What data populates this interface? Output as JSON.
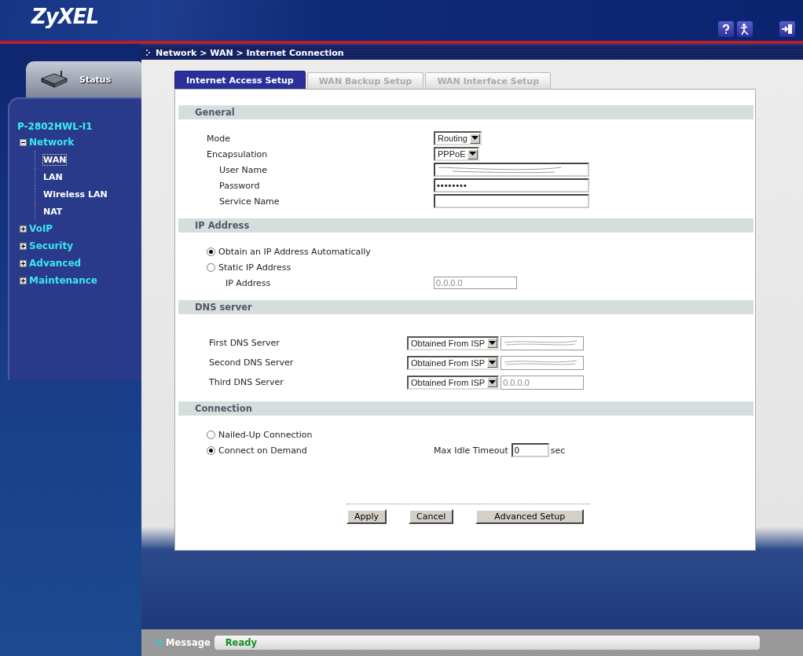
{
  "header": {
    "logo": "ZyXEL"
  },
  "sidebar": {
    "status_tab": "Status",
    "device": "P-2802HWL-I1",
    "tree": [
      {
        "label": "Network",
        "expanded": true,
        "children": [
          {
            "label": "WAN",
            "selected": true
          },
          {
            "label": "LAN",
            "selected": false
          },
          {
            "label": "Wireless LAN",
            "selected": false
          },
          {
            "label": "NAT",
            "selected": false
          }
        ]
      },
      {
        "label": "VoIP",
        "expanded": false
      },
      {
        "label": "Security",
        "expanded": false
      },
      {
        "label": "Advanced",
        "expanded": false
      },
      {
        "label": "Maintenance",
        "expanded": false
      }
    ]
  },
  "breadcrumb": "Network > WAN > Internet Connection",
  "tabs": [
    {
      "label": "Internet Access Setup",
      "selected": true
    },
    {
      "label": "WAN Backup Setup",
      "selected": false
    },
    {
      "label": "WAN Interface Setup",
      "selected": false
    }
  ],
  "sections": [
    {
      "title": "General",
      "rows": [
        {
          "kind": "select",
          "label": "Mode",
          "value": "Routing"
        },
        {
          "kind": "select",
          "label": "Encapsulation",
          "value": "PPPoE",
          "children": [
            {
              "kind": "text",
              "label": "User Name",
              "redacted": true
            },
            {
              "kind": "text",
              "label": "Password",
              "value": "••••••••"
            },
            {
              "kind": "text",
              "label": "Service Name"
            }
          ]
        }
      ]
    },
    {
      "title": "IP Address",
      "rows": [
        {
          "kind": "radio",
          "label": "Obtain an IP Address Automatically",
          "selected": true
        },
        {
          "kind": "radio",
          "label": "Static IP Address",
          "selected": false,
          "children": [
            {
              "kind": "text",
              "label": "IP Address",
              "value": "0.0.0.0",
              "disabled": true
            }
          ]
        }
      ]
    },
    {
      "title": "DNS server",
      "rows": [
        {
          "kind": "dns",
          "label": "First DNS Server",
          "value": "Obtained From ISP",
          "redacted": true
        },
        {
          "kind": "dns",
          "label": "Second DNS Server",
          "value": "Obtained From ISP",
          "redacted": true
        },
        {
          "kind": "dns",
          "label": "Third DNS Server",
          "value": "Obtained From ISP",
          "address": "0.0.0.0"
        }
      ]
    },
    {
      "title": "Connection",
      "rows": [
        {
          "kind": "radio",
          "label": "Nailed-Up Connection",
          "selected": false
        },
        {
          "kind": "radio",
          "label": "Connect on Demand",
          "selected": true,
          "timeout": {
            "label": "Max Idle Timeout",
            "value": "0",
            "unit": "sec"
          }
        }
      ]
    }
  ],
  "buttons": [
    "Apply",
    "Cancel",
    "Advanced Setup"
  ],
  "status_bar": {
    "label": "Message",
    "value": "Ready"
  }
}
